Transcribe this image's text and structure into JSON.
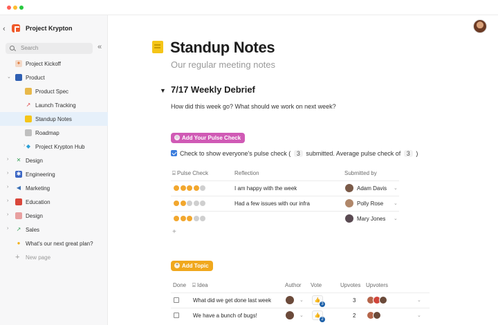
{
  "workspace": {
    "name": "Project Krypton"
  },
  "search": {
    "placeholder": "Search"
  },
  "sidebar": {
    "items": [
      {
        "label": "Project Kickoff",
        "icon": "rocket-icon",
        "level": 0,
        "expand": ""
      },
      {
        "label": "Product",
        "icon": "folder-icon",
        "level": 0,
        "expand": "open"
      },
      {
        "label": "Product Spec",
        "icon": "doc-icon",
        "level": 1,
        "expand": ""
      },
      {
        "label": "Launch Tracking",
        "icon": "launch-icon",
        "level": 1,
        "expand": ""
      },
      {
        "label": "Standup Notes",
        "icon": "note-icon",
        "level": 1,
        "expand": "",
        "active": true
      },
      {
        "label": "Roadmap",
        "icon": "map-icon",
        "level": 1,
        "expand": ""
      },
      {
        "label": "Project Krypton Hub",
        "icon": "gem-icon",
        "level": 1,
        "expand": "closed"
      },
      {
        "label": "Design",
        "icon": "design-icon",
        "level": 0,
        "expand": "closed"
      },
      {
        "label": "Engineering",
        "icon": "gear-icon",
        "level": 0,
        "expand": "closed"
      },
      {
        "label": "Marketing",
        "icon": "megaphone-icon",
        "level": 0,
        "expand": "closed"
      },
      {
        "label": "Education",
        "icon": "books-icon",
        "level": 0,
        "expand": "closed"
      },
      {
        "label": "Design",
        "icon": "palette-icon",
        "level": 0,
        "expand": "closed"
      },
      {
        "label": "Sales",
        "icon": "chart-icon",
        "level": 0,
        "expand": "closed"
      },
      {
        "label": "What's our next great plan?",
        "icon": "bulb-icon",
        "level": 0,
        "expand": ""
      }
    ],
    "new_page": "New page"
  },
  "page": {
    "title": "Standup Notes",
    "subtitle": "Our regular meeting notes",
    "section": "7/17 Weekly Debrief",
    "question": "How did this week go? What should we work on next week?"
  },
  "pulse": {
    "button": "Add Your Pulse Check",
    "check_prefix": "Check to show everyone's pulse check (",
    "submitted": "3",
    "check_mid": "submitted. Average pulse check of",
    "average": "3",
    "check_suffix": ")",
    "columns": {
      "pulse": "Pulse Check",
      "reflection": "Reflection",
      "submitted_by": "Submitted by"
    },
    "rows": [
      {
        "rating": 4,
        "reflection": "I am happy with the week",
        "person": "Adam Davis",
        "avatar_color": "#7a5a48"
      },
      {
        "rating": 2,
        "reflection": "Had a few issues with our infra",
        "person": "Polly Rose",
        "avatar_color": "#b0876a"
      },
      {
        "rating": 3,
        "reflection": "",
        "person": "Mary Jones",
        "avatar_color": "#5a4a52"
      }
    ],
    "add_symbol": "+"
  },
  "topics": {
    "button": "Add Topic",
    "columns": {
      "done": "Done",
      "idea": "Idea",
      "author": "Author",
      "vote": "Vote",
      "upvotes": "Upvotes",
      "upvoters": "Upvoters"
    },
    "rows": [
      {
        "idea": "What did we get done last week",
        "vote_badge": "3",
        "upvotes": "3"
      },
      {
        "idea": "We have a bunch of bugs!",
        "vote_badge": "2",
        "upvotes": "2"
      }
    ]
  },
  "colors": {
    "accent": "#3b7ddd",
    "pulse_button": "#d05ab5",
    "topic_button": "#f0a81e",
    "active_nav": "#e6f0fa"
  }
}
